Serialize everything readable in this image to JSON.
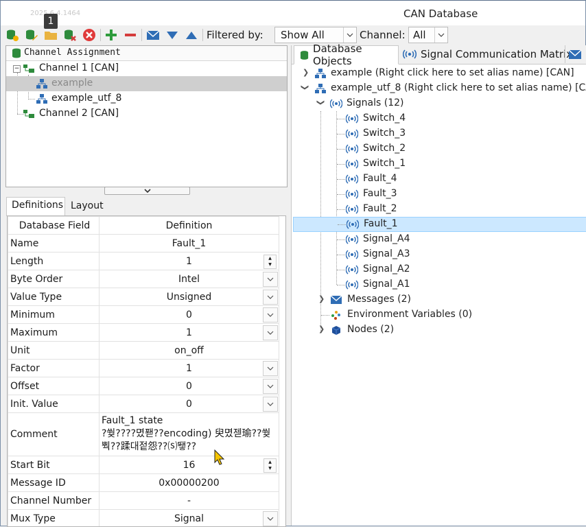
{
  "window": {
    "title": "CAN Database",
    "build": "2025.6.4.1464",
    "badge": "1"
  },
  "toolbar": {
    "filtered_label": "Filtered by:",
    "filter_value": "Show All",
    "channel_label": "Channel:",
    "channel_value": "All"
  },
  "assignment": {
    "header": "Channel Assignment",
    "channel1": "Channel 1 [CAN]",
    "db1": "example",
    "db2": "example_utf_8",
    "channel2": "Channel 2 [CAN]"
  },
  "left_tabs": {
    "definitions": "Definitions",
    "layout": "Layout"
  },
  "definitions": {
    "col_field": "Database Field",
    "col_def": "Definition",
    "rows": [
      {
        "field": "Name",
        "value": "Fault_1"
      },
      {
        "field": "Length",
        "value": "1"
      },
      {
        "field": "Byte Order",
        "value": "Intel"
      },
      {
        "field": "Value Type",
        "value": "Unsigned"
      },
      {
        "field": "Minimum",
        "value": "0"
      },
      {
        "field": "Maximum",
        "value": "1"
      },
      {
        "field": "Unit",
        "value": "on_off"
      },
      {
        "field": "Factor",
        "value": "1"
      },
      {
        "field": "Offset",
        "value": "0"
      },
      {
        "field": "Init. Value",
        "value": "0"
      },
      {
        "field": "Comment",
        "value_line1": "Fault_1 state",
        "value_line2": "?쒖????몄퐫??encoding) 臾몄젣瑜??쒖",
        "value_line3": "뿩??蹂대젙怨??⒮뙣??"
      },
      {
        "field": "Start Bit",
        "value": "16"
      },
      {
        "field": "Message ID",
        "value": "0x00000200"
      },
      {
        "field": "Channel Number",
        "value": "-"
      },
      {
        "field": "Mux Type",
        "value": "Signal"
      }
    ]
  },
  "right_tabs": {
    "db_objects": "Database Objects",
    "signal_matrix": "Signal Communication Matrix"
  },
  "objects": {
    "db_example": "example (Right click here to set alias name) [CAN]",
    "db_utf8": "example_utf_8 (Right click here to set alias name) [CAN]",
    "signals_group": "Signals (12)",
    "signals": [
      "Switch_4",
      "Switch_3",
      "Switch_2",
      "Switch_1",
      "Fault_4",
      "Fault_3",
      "Fault_2",
      "Fault_1",
      "Signal_A4",
      "Signal_A3",
      "Signal_A2",
      "Signal_A1"
    ],
    "selected_signal": "Fault_1",
    "messages_group": "Messages (2)",
    "env_group": "Environment Variables (0)",
    "nodes_group": "Nodes (2)"
  },
  "colors": {
    "accent_blue": "#2f6db5",
    "selection": "#cce8ff",
    "add_green": "#2e9b3c",
    "remove_red": "#d43c3c"
  }
}
